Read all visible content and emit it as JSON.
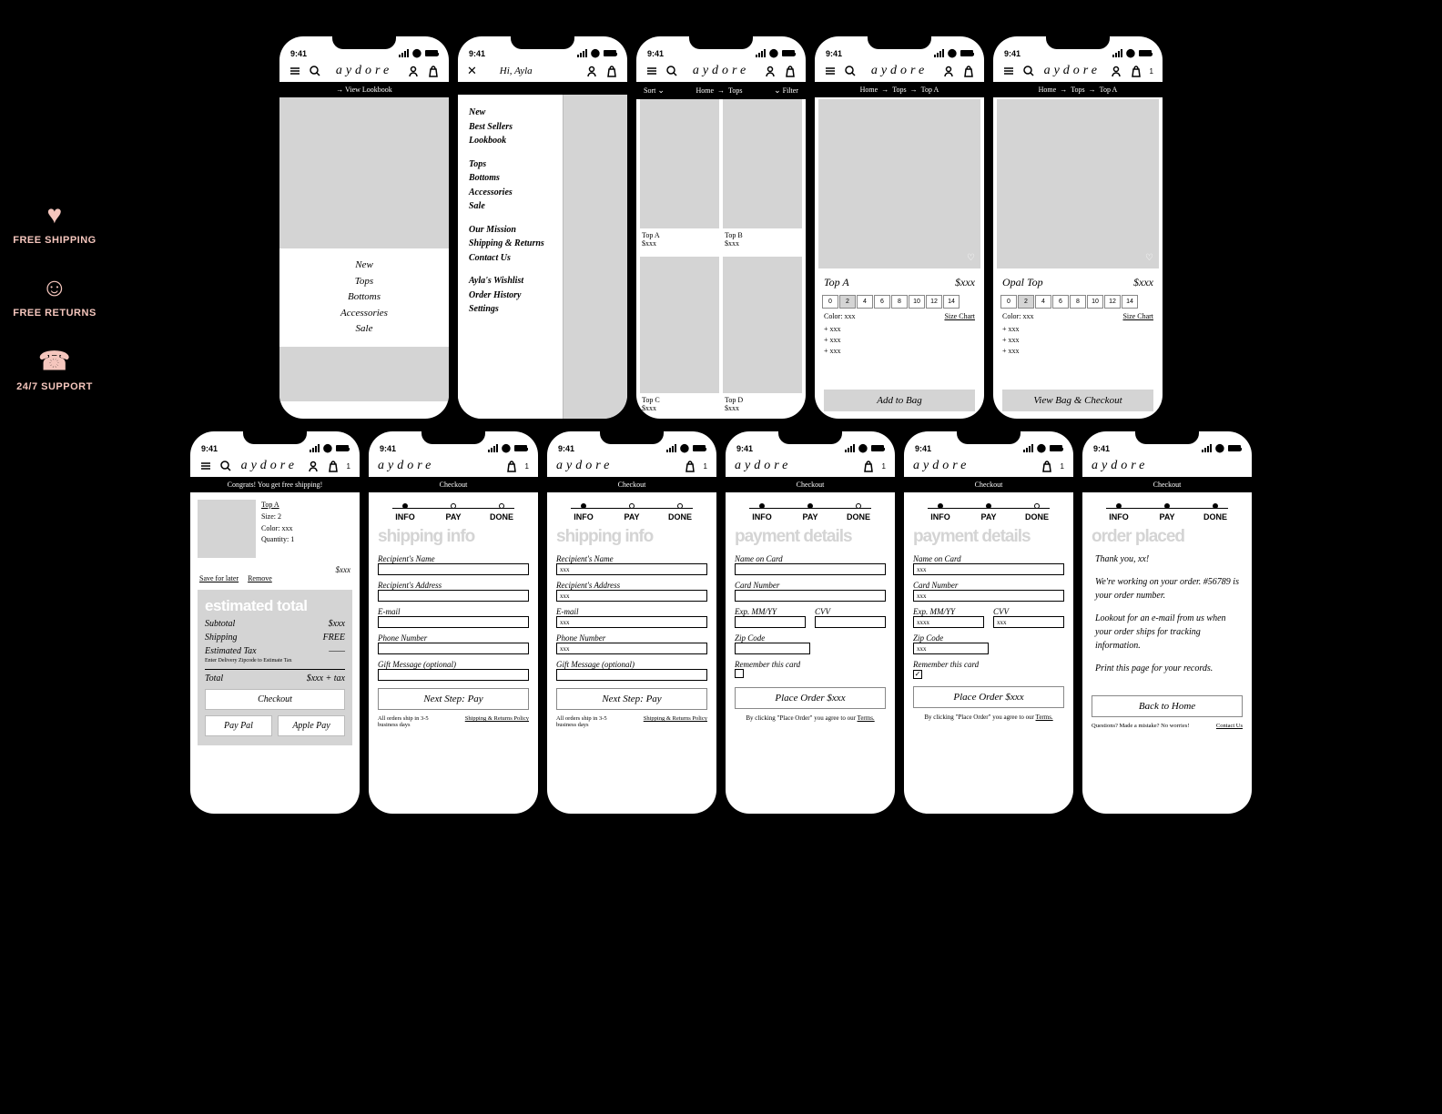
{
  "brand": "aydore",
  "status_time": "9:41",
  "perks": [
    {
      "icon": "♥",
      "label": "FREE SHIPPING"
    },
    {
      "icon": "☺",
      "label": "FREE RETURNS"
    },
    {
      "icon": "☎",
      "label": "24/7 SUPPORT"
    }
  ],
  "home": {
    "banner": "→ View Lookbook",
    "categories": [
      "New",
      "Tops",
      "Bottoms",
      "Accessories",
      "Sale"
    ]
  },
  "drawer": {
    "greeting": "Hi, Ayla",
    "group1": [
      "New",
      "Best Sellers",
      "Lookbook"
    ],
    "group2": [
      "Tops",
      "Bottoms",
      "Accessories",
      "Sale"
    ],
    "group3": [
      "Our Mission",
      "Shipping & Returns",
      "Contact Us"
    ],
    "group4": [
      "Ayla's Wishlist",
      "Order History",
      "Settings"
    ]
  },
  "plp": {
    "sort": "Sort",
    "crumb": [
      "Home",
      "Tops"
    ],
    "filter": "Filter",
    "products": [
      {
        "name": "Top A",
        "price": "$xxx"
      },
      {
        "name": "Top B",
        "price": "$xxx"
      },
      {
        "name": "Top C",
        "price": "$xxx"
      },
      {
        "name": "Top D",
        "price": "$xxx"
      }
    ]
  },
  "pdp1": {
    "crumb": [
      "Home",
      "Tops",
      "Top A"
    ],
    "name": "Top A",
    "price": "$xxx",
    "sizes": [
      "0",
      "2",
      "4",
      "6",
      "8",
      "10",
      "12",
      "14"
    ],
    "selected": "2",
    "color_label": "Color: xxx",
    "size_chart": "Size Chart",
    "bullets": [
      "+ xxx",
      "+ xxx",
      "+ xxx"
    ],
    "cta": "Add to Bag"
  },
  "pdp2": {
    "crumb": [
      "Home",
      "Tops",
      "Top A"
    ],
    "name": "Opal Top",
    "price": "$xxx",
    "sizes": [
      "0",
      "2",
      "4",
      "6",
      "8",
      "10",
      "12",
      "14"
    ],
    "selected": "2",
    "color_label": "Color: xxx",
    "size_chart": "Size Chart",
    "bullets": [
      "+ xxx",
      "+ xxx",
      "+ xxx"
    ],
    "cta": "View Bag & Checkout"
  },
  "cart": {
    "banner": "Congrats! You get free shipping!",
    "item": {
      "name": "Top A",
      "size": "Size: 2",
      "color": "Color: xxx",
      "qty": "Quantity: 1",
      "price": "$xxx"
    },
    "save": "Save for later",
    "remove": "Remove",
    "head": "estimated total",
    "lines": [
      {
        "l": "Subtotal",
        "r": "$xxx"
      },
      {
        "l": "Shipping",
        "r": "FREE"
      },
      {
        "l": "Estimated Tax",
        "r": "——"
      }
    ],
    "tax_note": "Enter Delivery Zipcode to Estimate Tax",
    "total": {
      "l": "Total",
      "r": "$xxx + tax"
    },
    "checkout": "Checkout",
    "paypal": "Pay Pal",
    "applepay": "Apple Pay",
    "bag_count": "1"
  },
  "checkout": {
    "title": "Checkout",
    "steps": [
      "INFO",
      "PAY",
      "DONE"
    ],
    "ship_head": "shipping info",
    "pay_head": "payment details",
    "done_head": "order placed",
    "ship_fields": [
      "Recipient's Name",
      "Recipient's Address",
      "E-mail",
      "Phone Number",
      "Gift Message (optional)"
    ],
    "filled": "xxx",
    "next_pay": "Next Step: Pay",
    "ship_note": "All orders ship in 3-5 business days",
    "ship_link": "Shipping & Returns Policy",
    "pay_fields": {
      "name": "Name on Card",
      "num": "Card Number",
      "exp": "Exp. MM/YY",
      "cvv": "CVV",
      "zip": "Zip Code",
      "remember": "Remember this card"
    },
    "pay_filled": {
      "xxx": "xxx",
      "xxxx": "xxxx"
    },
    "place": "Place Order $xxx",
    "terms_pre": "By clicking \"Place Order\" you agree to our ",
    "terms": "Terms.",
    "done": {
      "thank": "Thank you, xx!",
      "p1": "We're working on your order. #56789 is your order number.",
      "p2": "Lookout for an e-mail from us when your order ships for tracking information.",
      "p3": "Print this page for your records.",
      "btn": "Back to Home",
      "q": "Questions? Made a mistake? No worries!",
      "contact": "Contact Us"
    }
  }
}
